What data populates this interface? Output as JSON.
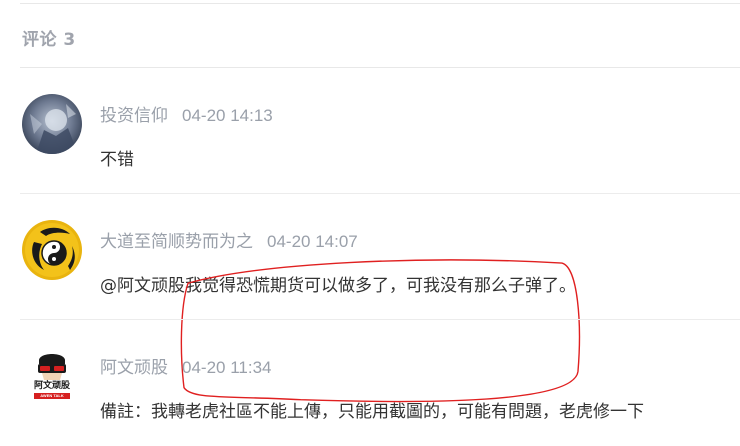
{
  "section": {
    "title": "评论 3"
  },
  "comments": [
    {
      "user": "投资信仰",
      "time": "04-20 14:13",
      "text": "不错"
    },
    {
      "user": "大道至简顺势而为之",
      "time": "04-20 14:07",
      "mention": "@阿文顽股",
      "text": "我觉得恐慌期货可以做多了，可我没有那么子弹了。"
    },
    {
      "user": "阿文顽股",
      "time": "04-20 11:34",
      "text": "備註：我轉老虎社區不能上傳，只能用截圖的，可能有問題，老虎修一下",
      "avatar_text": "阿文顽股",
      "avatar_subtext": "AWEN TALK"
    }
  ],
  "colors": {
    "muted": "#9aa0aa",
    "body": "#333333",
    "annotation": "#e02020",
    "divider": "#ececec"
  }
}
